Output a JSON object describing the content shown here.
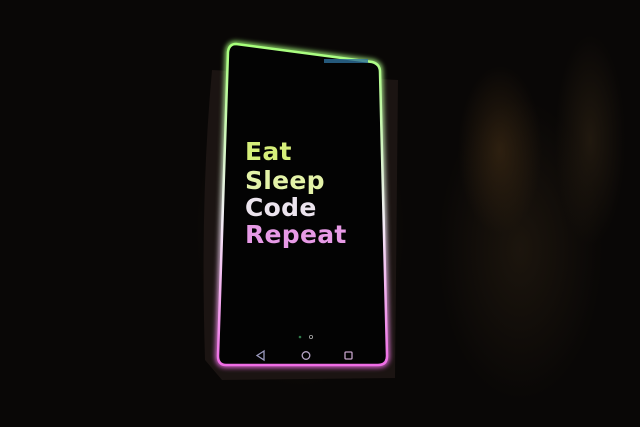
{
  "screen": {
    "lines": [
      "Eat",
      "Sleep",
      "Code",
      "Repeat"
    ],
    "line_colors": [
      "#d6ef7a",
      "#e4f3a8",
      "#ece4ee",
      "#e79ae6"
    ],
    "border_gradient": [
      "#a6ff7a",
      "#ffffff",
      "#f06de6"
    ]
  },
  "nav_bar": {
    "icons": [
      "back-triangle-icon",
      "home-circle-icon",
      "recents-square-icon"
    ]
  }
}
